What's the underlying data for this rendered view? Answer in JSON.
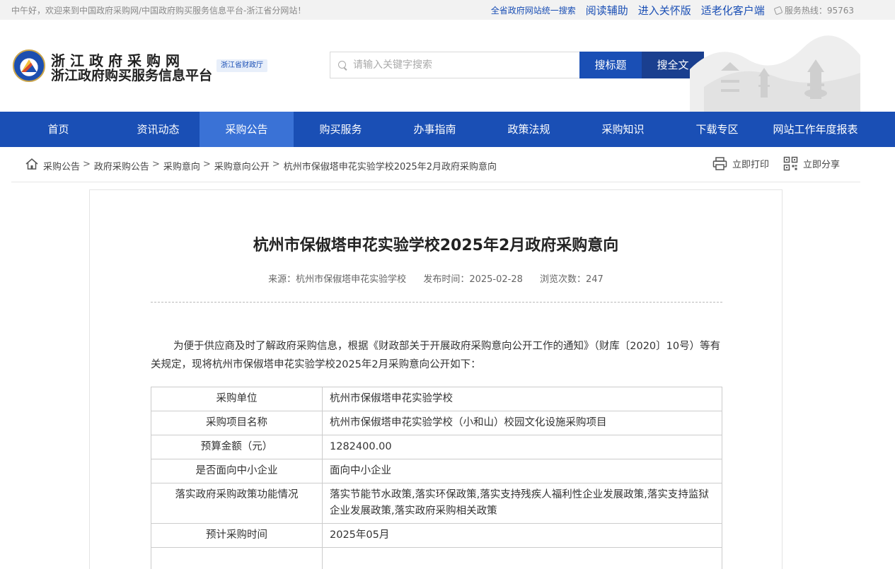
{
  "topbar": {
    "welcome": "中午好，欢迎来到中国政府采购网/中国政府购买服务信息平台-浙江省分网站！",
    "search_all": "全省政府网站统一搜索",
    "reading_aid": "阅读辅助",
    "care_mode": "进入关怀版",
    "elderly_client": "适老化客户端",
    "hotline": "服务热线：95763"
  },
  "header": {
    "site_name1": "浙江政府采购网",
    "site_name2": "浙江政府购买服务信息平台",
    "dept_badge": "浙江省财政厅",
    "search_placeholder": "请输入关键字搜索",
    "btn_title": "搜标题",
    "btn_full": "搜全文"
  },
  "nav": [
    "首页",
    "资讯动态",
    "采购公告",
    "购买服务",
    "办事指南",
    "政策法规",
    "采购知识",
    "下载专区",
    "网站工作年度报表"
  ],
  "nav_active_index": 2,
  "breadcrumb": [
    "采购公告",
    "政府采购公告",
    "采购意向",
    "采购意向公开",
    "杭州市保俶塔申花实验学校2025年2月政府采购意向"
  ],
  "breadcrumb_sep": ">",
  "actions": {
    "print": "立即打印",
    "share": "立即分享"
  },
  "article": {
    "title": "杭州市保俶塔申花实验学校2025年2月政府采购意向",
    "source": "来源：杭州市保俶塔申花实验学校",
    "publish_time": "发布时间：2025-02-28",
    "views": "浏览次数：247",
    "intro": "为便于供应商及时了解政府采购信息，根据《财政部关于开展政府采购意向公开工作的通知》（财库〔2020〕10号）等有关规定，现将杭州市保俶塔申花实验学校2025年2月采购意向公开如下：",
    "table": [
      {
        "k": "采购单位",
        "v": "杭州市保俶塔申花实验学校"
      },
      {
        "k": "采购项目名称",
        "v": "杭州市保俶塔申花实验学校（小和山）校园文化设施采购项目"
      },
      {
        "k": "预算金额（元）",
        "v": "1282400.00"
      },
      {
        "k": "是否面向中小企业",
        "v": "面向中小企业"
      },
      {
        "k": "落实政府采购政策功能情况",
        "v": "落实节能节水政策,落实环保政策,落实支持残疾人福利性企业发展政策,落实支持监狱企业发展政策,落实政府采购相关政策"
      },
      {
        "k": "预计采购时间",
        "v": "2025年05月"
      },
      {
        "k": "",
        "v": ""
      }
    ]
  },
  "colors": {
    "brand_blue": "#1a4fb5",
    "nav_active": "#3a72d6"
  }
}
